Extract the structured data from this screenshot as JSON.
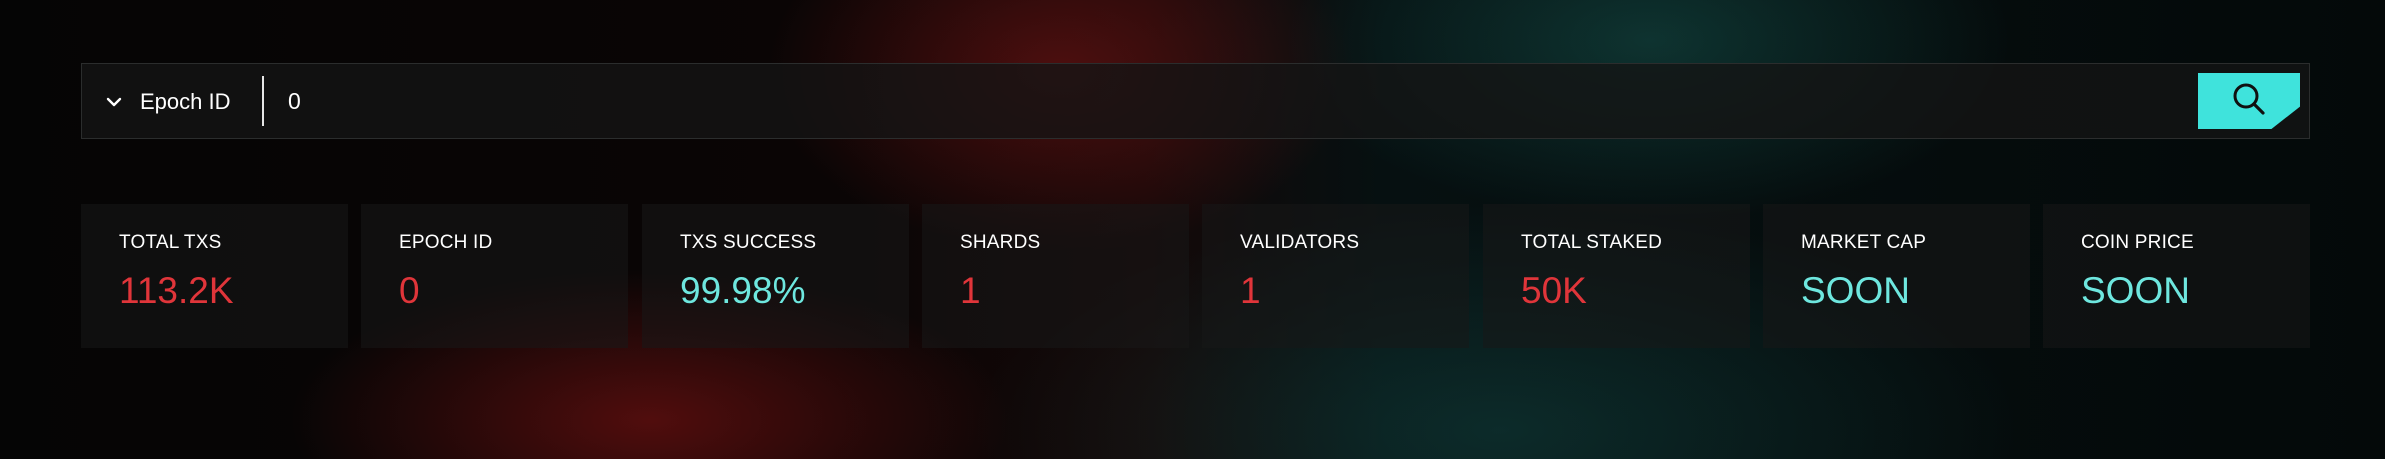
{
  "search": {
    "filter_label": "Epoch ID",
    "filter_icon": "chevron-down-icon",
    "input_value": "0",
    "button_icon": "search-icon"
  },
  "colors": {
    "accent_cyan": "#3fe3dc",
    "value_red": "#e0353a",
    "value_cyan": "#6ee7df"
  },
  "stats": [
    {
      "label": "TOTAL TXS",
      "value": "113.2K",
      "tone": "red"
    },
    {
      "label": "EPOCH ID",
      "value": "0",
      "tone": "red"
    },
    {
      "label": "TXS SUCCESS",
      "value": "99.98%",
      "tone": "cyan"
    },
    {
      "label": "SHARDS",
      "value": "1",
      "tone": "red"
    },
    {
      "label": "VALIDATORS",
      "value": "1",
      "tone": "red"
    },
    {
      "label": "TOTAL STAKED",
      "value": "50K",
      "tone": "red"
    },
    {
      "label": "MARKET CAP",
      "value": "SOON",
      "tone": "cyan"
    },
    {
      "label": "COIN PRICE",
      "value": "SOON",
      "tone": "cyan"
    }
  ]
}
